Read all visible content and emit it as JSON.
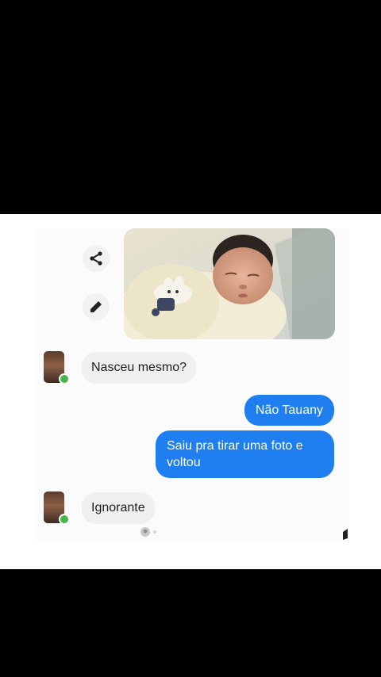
{
  "conversation": {
    "messages": [
      {
        "sender": "contact",
        "text": "Nasceu mesmo?"
      },
      {
        "sender": "me",
        "text": "Não Tauany"
      },
      {
        "sender": "me",
        "text": "Saiu pra tirar uma foto e voltou"
      },
      {
        "sender": "contact",
        "text": "Ignorante"
      }
    ]
  },
  "icons": {
    "share": "share-icon",
    "edit": "pencil-icon",
    "seen": "seen-avatar-icon"
  },
  "colors": {
    "outgoing_bubble": "#1f7ff0",
    "incoming_bubble": "#f1f0f0",
    "online": "#44b74a"
  }
}
